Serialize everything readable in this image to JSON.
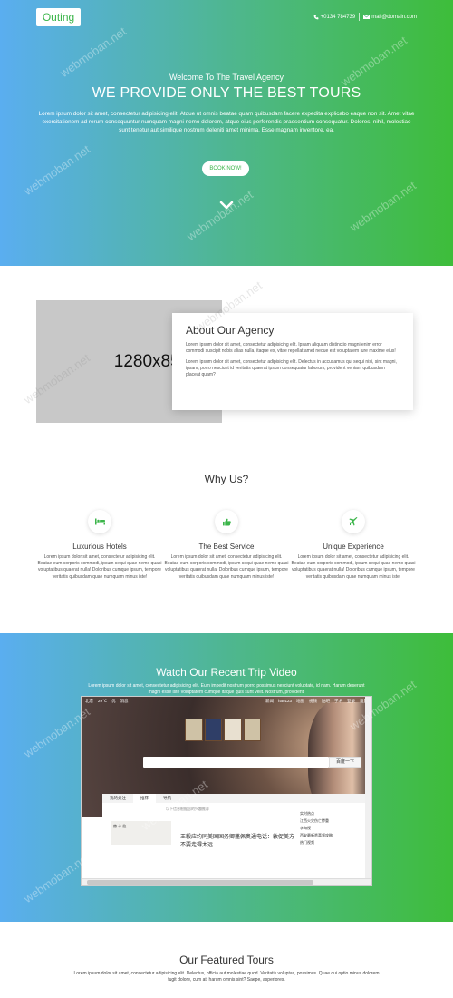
{
  "header": {
    "logo": "Outing",
    "phone": "+0134 784739",
    "email": "mail@domain.com"
  },
  "hero": {
    "welcome": "Welcome To The Travel Agency",
    "headline": "WE PROVIDE ONLY THE BEST TOURS",
    "lead": "Lorem ipsum dolor sit amet, consectetur adipisicing elit. Atque ut omnis beatae quam quibusdam facere expedita explicabo eaque non sit. Amet vitae exercitationem ad rerum consequuntur numquam magni nemo dolorem, atque eius perferendis praesentium consequatur. Dolores, nihil, molestiae sunt tenetur aut similique nostrum deleniti amet minima. Esse magnam inventore, ea.",
    "button": "BOOK NOW!"
  },
  "about": {
    "image_label": "1280x854",
    "title": "About Our Agency",
    "p1": "Lorem ipsum dolor sit amet, consectetur adipisicing elit. Ipsam aliquam distinctio magni enim error commodi suscipit nobis alias nulla, itaque ex, vitae repellat amet neque est voluptatem iure maxime eius!",
    "p2": "Lorem ipsum dolor sit amet, consectetur adipisicing elit. Delectus in accusamus qui sequi nisi, sint magni, ipsam, porro nesciunt id veritatis quaerat ipsum consequatur laborum, provident veniam quibusdam placeat quam?"
  },
  "why": {
    "title": "Why Us?",
    "items": [
      {
        "icon": "bed-icon",
        "title": "Luxurious Hotels",
        "text": "Lorem ipsum dolor sit amet, consectetur adipisicing elit. Beatae eum corporis commodi, ipsum sequi quae nemo quasi voluptatibus quaerat nulla! Doloribus cumque ipsum, tempore veritatis quibusdam quae numquam minus iste!"
      },
      {
        "icon": "thumbs-up-icon",
        "title": "The Best Service",
        "text": "Lorem ipsum dolor sit amet, consectetur adipisicing elit. Beatae eum corporis commodi, ipsum sequi quae nemo quasi voluptatibus quaerat nulla! Doloribus cumque ipsum, tempore veritatis quibusdam quae numquam minus iste!"
      },
      {
        "icon": "plane-icon",
        "title": "Unique Experience",
        "text": "Lorem ipsum dolor sit amet, consectetur adipisicing elit. Beatae eum corporis commodi, ipsum sequi quae nemo quasi voluptatibus quaerat nulla! Doloribus cumque ipsum, tempore veritatis quibusdam quae numquam minus iste!"
      }
    ]
  },
  "video": {
    "title": "Watch Our Recent Trip Video",
    "text": "Lorem ipsum dolor sit amet, consectetur adipisicing elit. Eum impedit nostrum porro possimus nesciunt voluptate, id nam. Harum deserunt magni esse iste voluptatem cumque itaque quis sunt velit. Nostrum, provident!",
    "player": {
      "topbar_left": [
        "北京",
        "29℃",
        "优",
        "消息"
      ],
      "topbar_right": [
        "新闻",
        "hao123",
        "地图",
        "视频",
        "贴吧",
        "学术",
        "登录",
        "设置"
      ],
      "search_button": "百度一下",
      "tabs": [
        "我的关注",
        "推荐",
        "导航"
      ],
      "sub": "以下信息根据您的兴趣推荐",
      "news": "王毅应约同美国国务卿蓬佩奥通电话：敦促美方不要走得太远",
      "thumb_caption": "赫 卡 拉",
      "right_title": "实时热点",
      "right_items": [
        "江西火灾伤亡惨重",
        "李海视",
        "西安最新悉喜领攻略",
        "热门视频"
      ]
    }
  },
  "featured": {
    "title": "Our Featured Tours",
    "text": "Lorem ipsum dolor sit amet, consectetur adipisicing elit. Delectus, officia aut molestiae quod. Veritatis voluptas, possimus. Quae qui optio minus dolorem fugit dolore, cum at, harum omnis sint? Saepe, asperiores."
  },
  "watermark": "webmoban.net",
  "colors": {
    "accent": "#3bb54a",
    "gradient_start": "#5aaef0",
    "gradient_end": "#3ebd3a"
  }
}
